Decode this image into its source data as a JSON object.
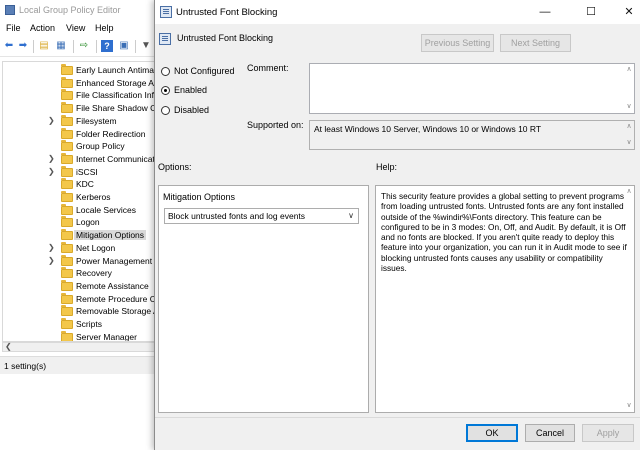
{
  "background_window": {
    "title": "Local Group Policy Editor",
    "menu": [
      "File",
      "Action",
      "View",
      "Help"
    ],
    "tree_items": [
      {
        "label": "Early Launch Antimal",
        "expandable": false
      },
      {
        "label": "Enhanced Storage Ac",
        "expandable": false
      },
      {
        "label": "File Classification Infr",
        "expandable": false
      },
      {
        "label": "File Share Shadow Co",
        "expandable": false
      },
      {
        "label": "Filesystem",
        "expandable": true
      },
      {
        "label": "Folder Redirection",
        "expandable": false
      },
      {
        "label": "Group Policy",
        "expandable": false
      },
      {
        "label": "Internet Communicati",
        "expandable": true
      },
      {
        "label": "iSCSI",
        "expandable": true
      },
      {
        "label": "KDC",
        "expandable": false
      },
      {
        "label": "Kerberos",
        "expandable": false
      },
      {
        "label": "Locale Services",
        "expandable": false
      },
      {
        "label": "Logon",
        "expandable": false
      },
      {
        "label": "Mitigation Options",
        "expandable": false,
        "selected": true
      },
      {
        "label": "Net Logon",
        "expandable": true
      },
      {
        "label": "Power Management",
        "expandable": true
      },
      {
        "label": "Recovery",
        "expandable": false
      },
      {
        "label": "Remote Assistance",
        "expandable": false
      },
      {
        "label": "Remote Procedure Ca",
        "expandable": false
      },
      {
        "label": "Removable Storage A",
        "expandable": false
      },
      {
        "label": "Scripts",
        "expandable": false
      },
      {
        "label": "Server Manager",
        "expandable": false
      }
    ],
    "status": "1 setting(s)"
  },
  "dialog": {
    "title": "Untrusted Font Blocking",
    "header_title": "Untrusted Font Blocking",
    "previous_setting": "Previous Setting",
    "next_setting": "Next Setting",
    "radios": {
      "not_configured": "Not Configured",
      "enabled": "Enabled",
      "disabled": "Disabled",
      "selected": "enabled"
    },
    "comment_label": "Comment:",
    "comment_value": "",
    "supported_label": "Supported on:",
    "supported_value": "At least Windows 10 Server, Windows 10 or Windows 10 RT",
    "options_label": "Options:",
    "help_label": "Help:",
    "mitigation_label": "Mitigation Options",
    "mitigation_value": "Block untrusted fonts and log events",
    "help_text": "This security feature provides a global setting to prevent programs from loading untrusted fonts. Untrusted fonts are any font installed outside of the %windir%\\Fonts directory. This feature can be configured to be in 3 modes: On, Off, and Audit. By default, it is Off and no fonts are blocked. If you aren't quite ready to deploy this feature into your organization, you can run it in Audit mode to see if blocking untrusted fonts causes any usability or compatibility issues.",
    "ok": "OK",
    "cancel": "Cancel",
    "apply": "Apply"
  },
  "colors": {
    "dialog_bg": "#f0f0f0",
    "accent": "#0078d7",
    "folder": "#f3c74a"
  }
}
